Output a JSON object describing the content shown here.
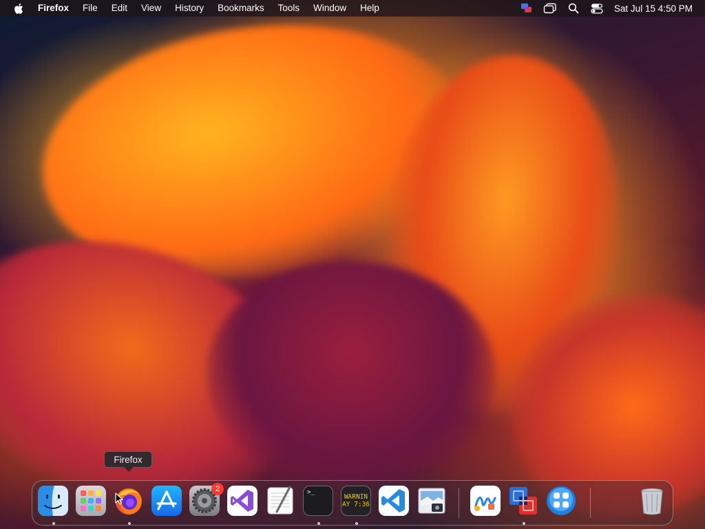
{
  "menubar": {
    "apple_icon": "apple-logo-icon",
    "app_name": "Firefox",
    "menus": [
      "File",
      "Edit",
      "View",
      "History",
      "Bookmarks",
      "Tools",
      "Window",
      "Help"
    ],
    "status_icons": [
      "screen-sharing-icon",
      "window-overlap-icon",
      "search-icon",
      "control-center-icon"
    ],
    "clock": "Sat Jul 15  4:50 PM"
  },
  "tooltip": {
    "label": "Firefox"
  },
  "dock": {
    "apps": [
      {
        "id": "finder",
        "icon": "finder-icon",
        "running": true
      },
      {
        "id": "launchpad",
        "icon": "launchpad-icon",
        "running": false
      },
      {
        "id": "firefox",
        "icon": "firefox-icon",
        "running": true
      },
      {
        "id": "app-store",
        "icon": "app-store-icon",
        "running": false
      },
      {
        "id": "system-settings",
        "icon": "settings-gear-icon",
        "running": false,
        "badge": "2"
      },
      {
        "id": "visual-studio",
        "icon": "visual-studio-icon",
        "running": false
      },
      {
        "id": "textedit",
        "icon": "textedit-icon",
        "running": false
      },
      {
        "id": "terminal",
        "icon": "terminal-icon",
        "running": true,
        "text": ">_"
      },
      {
        "id": "console",
        "icon": "console-icon",
        "running": true,
        "text_line1": "WARNIN",
        "text_line2": "AY 7:36"
      },
      {
        "id": "vscode",
        "icon": "vscode-icon",
        "running": false
      },
      {
        "id": "preview",
        "icon": "preview-icon",
        "running": false
      },
      {
        "id": "freeform",
        "icon": "freeform-icon",
        "running": false
      },
      {
        "id": "vmware-fusion",
        "icon": "vmware-fusion-icon",
        "running": true
      },
      {
        "id": "screens",
        "icon": "grid-app-icon",
        "running": false
      },
      {
        "id": "trash",
        "icon": "trash-icon",
        "running": false
      }
    ]
  },
  "colors": {
    "menubar_bg": "#1e1418",
    "badge": "#ff3b30",
    "firefox_orange": "#ff7a1a",
    "vscode_blue": "#2a8bdc"
  }
}
